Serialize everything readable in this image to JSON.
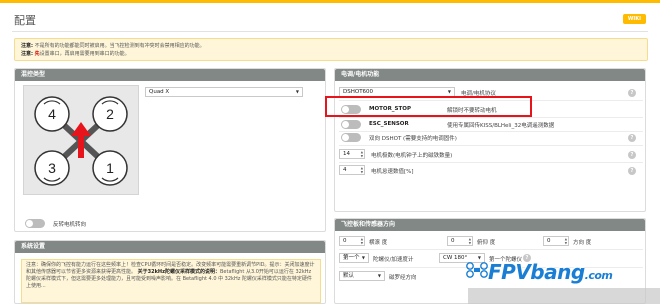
{
  "header": {
    "title": "配置",
    "wiki_label": "WIKI"
  },
  "notice": {
    "line1_prefix": "注意:",
    "line1_text": "不是所有的功能都能同时被启用。当飞控检测到有冲突时会禁用相应的功能。",
    "line2_prefix": "注意:",
    "line2_red": "先",
    "line2_text": "设置串口，再启用需要用到串口的功能。"
  },
  "mixer": {
    "panel_title": "混控类型",
    "selected": "Quad X",
    "reverse_label": "反转电机转向",
    "motor_numbers": [
      "4",
      "2",
      "3",
      "1"
    ]
  },
  "system": {
    "panel_title": "系统设置",
    "warning_prefix": "注意：",
    "warning_text": "确保你的飞控有能力运行在这些频率上！检查CPU循环时间是否稳定。改变频率可能需要重新调节PID。提示：关闭加速度计和其他传感器可以节省更多资源来获得更高性能。",
    "warning_bold": "关于32kHz陀螺仪采样模式的说明：",
    "warning_text2": "Betaflight 从3.0开始可以运行在 32kHz 陀螺仪采样模式下，但这需要更多处理能力，且可能受到噪声影响。在 Betaflight 4.0 中 32kHz 陀螺仪采样模式只能在特定硬件上使用..."
  },
  "motor": {
    "panel_title": "电调/电机功能",
    "protocol_value": "DSHOT600",
    "protocol_label": "电调/电机协议",
    "motor_stop_label": "MOTOR_STOP",
    "motor_stop_desc": "解锁时不要转动电机",
    "esc_sensor_label": "ESC_SENSOR",
    "esc_sensor_desc": "使用专属回传KISS/BLHeli_32电调遥测数据",
    "bidir_label": "双向 DSHOT (需要支持的电调固件)",
    "poles_value": "14",
    "poles_label": "电机极数(电机钟子上的磁铁数量)",
    "idle_value": "4",
    "idle_label": "电机怠速数值[%]"
  },
  "board": {
    "panel_title": "飞控板和传感器方向",
    "roll_value": "0",
    "roll_label": "横滚 度",
    "pitch_value": "0",
    "pitch_label": "俯仰 度",
    "yaw_value": "0",
    "yaw_label": "方向 度",
    "gyro_select": "第一个",
    "gyro_select_label": "陀螺仪/加速度计",
    "align_select": "CW 180°",
    "align_label": "第一个陀螺仪",
    "default_select": "默认",
    "default_label": "磁罗经方向"
  },
  "watermark": {
    "text": "FPVbang",
    "suffix": ".com"
  },
  "colors": {
    "accent": "#ffbb00",
    "panel_header": "#828885",
    "highlight": "#e8141b",
    "arrow": "#e8141b"
  }
}
